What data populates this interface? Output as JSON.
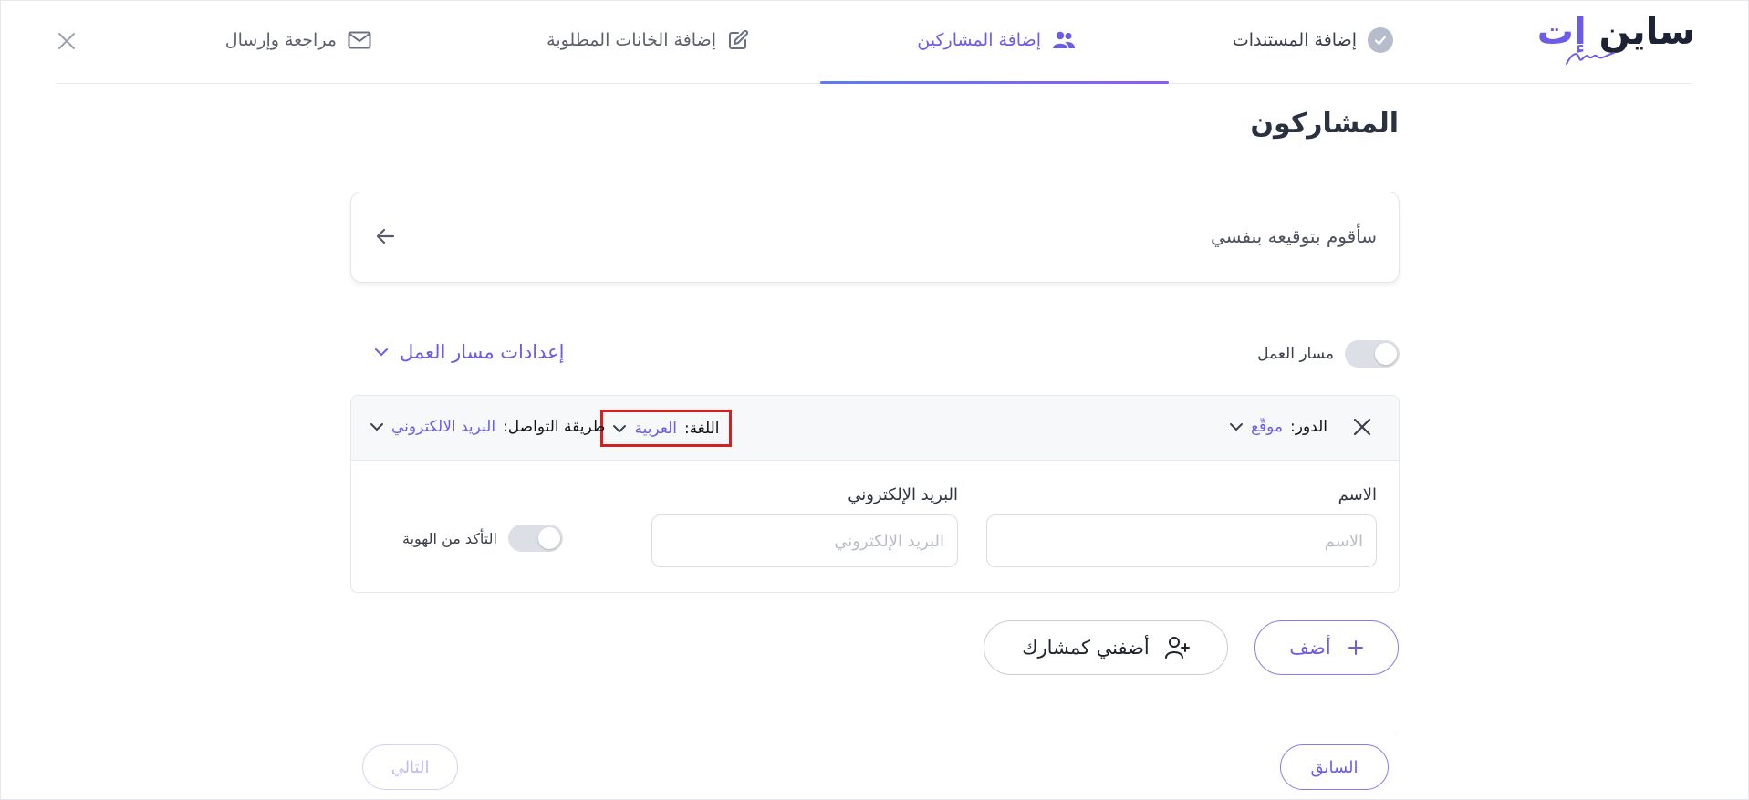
{
  "app": {
    "logo_text_main": "ساين ",
    "logo_text_accent": "إت"
  },
  "steps": [
    {
      "label": "إضافة المستندات",
      "icon": "check-circle-icon",
      "state": "completed"
    },
    {
      "label": "إضافة المشاركين",
      "icon": "users-icon",
      "state": "active"
    },
    {
      "label": "إضافة الخانات المطلوبة",
      "icon": "edit-icon",
      "state": "pending"
    },
    {
      "label": "مراجعة وإرسال",
      "icon": "envelope-icon",
      "state": "pending"
    }
  ],
  "page": {
    "title": "المشاركون"
  },
  "self_sign": {
    "label": "سأقوم بتوقيعه بنفسي"
  },
  "workflow": {
    "toggle_label": "مسار العمل",
    "toggle_on": false,
    "settings_label": "إعدادات مسار العمل"
  },
  "participant": {
    "role_key": "الدور:",
    "role_value": "موقّع",
    "language_key": "اللغة:",
    "language_value": "العربية",
    "contact_key": "طريقة التواصل:",
    "contact_value": "البريد الالكتروني",
    "name_label": "الاسم",
    "name_placeholder": "الاسم",
    "name_value": "",
    "email_label": "البريد الإلكتروني",
    "email_placeholder": "البريد الإلكتروني",
    "email_value": "",
    "identity_label": "التأكد من الهوية",
    "identity_on": false
  },
  "actions": {
    "add_label": "أضف",
    "add_me_label": "أضفني كمشارك",
    "prev_label": "السابق",
    "next_label": "التالي"
  },
  "colors": {
    "accent": "#6c5ce7",
    "highlight_box": "#d32020"
  }
}
